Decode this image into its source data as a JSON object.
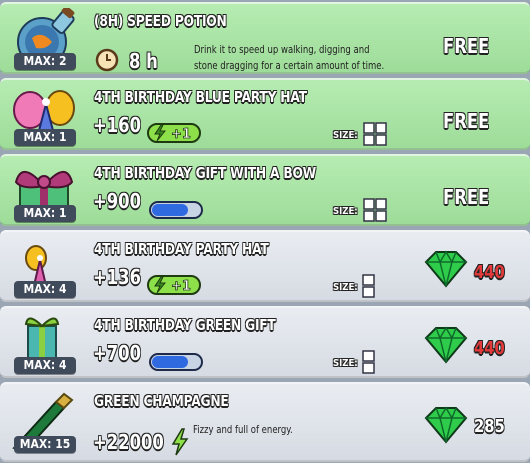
{
  "colors": {
    "free_row": "#a8e4a3",
    "paid_row": "#dde1e8",
    "gem_price": "#e23a3a",
    "gem_price_plain": "#ffffff"
  },
  "items": [
    {
      "icon": "speed-potion-icon",
      "max": "MAX: 2",
      "title": "(8H) SPEED POTION",
      "duration": "8 h",
      "description_line1": "Drink it to speed up walking, digging and",
      "description_line2": "stone dragging for a certain amount of time.",
      "price": "FREE"
    },
    {
      "icon": "blue-party-hat-icon",
      "max": "MAX: 1",
      "title": "4TH BIRTHDAY BLUE PARTY HAT",
      "value": "+160",
      "energy_bonus": "+1",
      "size_label": "SIZE:",
      "price": "FREE"
    },
    {
      "icon": "gift-with-bow-icon",
      "max": "MAX: 1",
      "title": "4TH BIRTHDAY GIFT WITH A BOW",
      "value": "+900",
      "size_label": "SIZE:",
      "price": "FREE"
    },
    {
      "icon": "party-hat-icon",
      "max": "MAX: 4",
      "title": "4TH BIRTHDAY PARTY HAT",
      "value": "+136",
      "energy_bonus": "+1",
      "size_label": "SIZE:",
      "price": "440"
    },
    {
      "icon": "green-gift-icon",
      "max": "MAX: 4",
      "title": "4TH BIRTHDAY GREEN GIFT",
      "value": "+700",
      "size_label": "SIZE:",
      "price": "440"
    },
    {
      "icon": "green-champagne-icon",
      "max": "MAX: 15",
      "title": "GREEN CHAMPAGNE",
      "value": "+22000",
      "description": "Fizzy and full of energy.",
      "price": "285"
    }
  ]
}
